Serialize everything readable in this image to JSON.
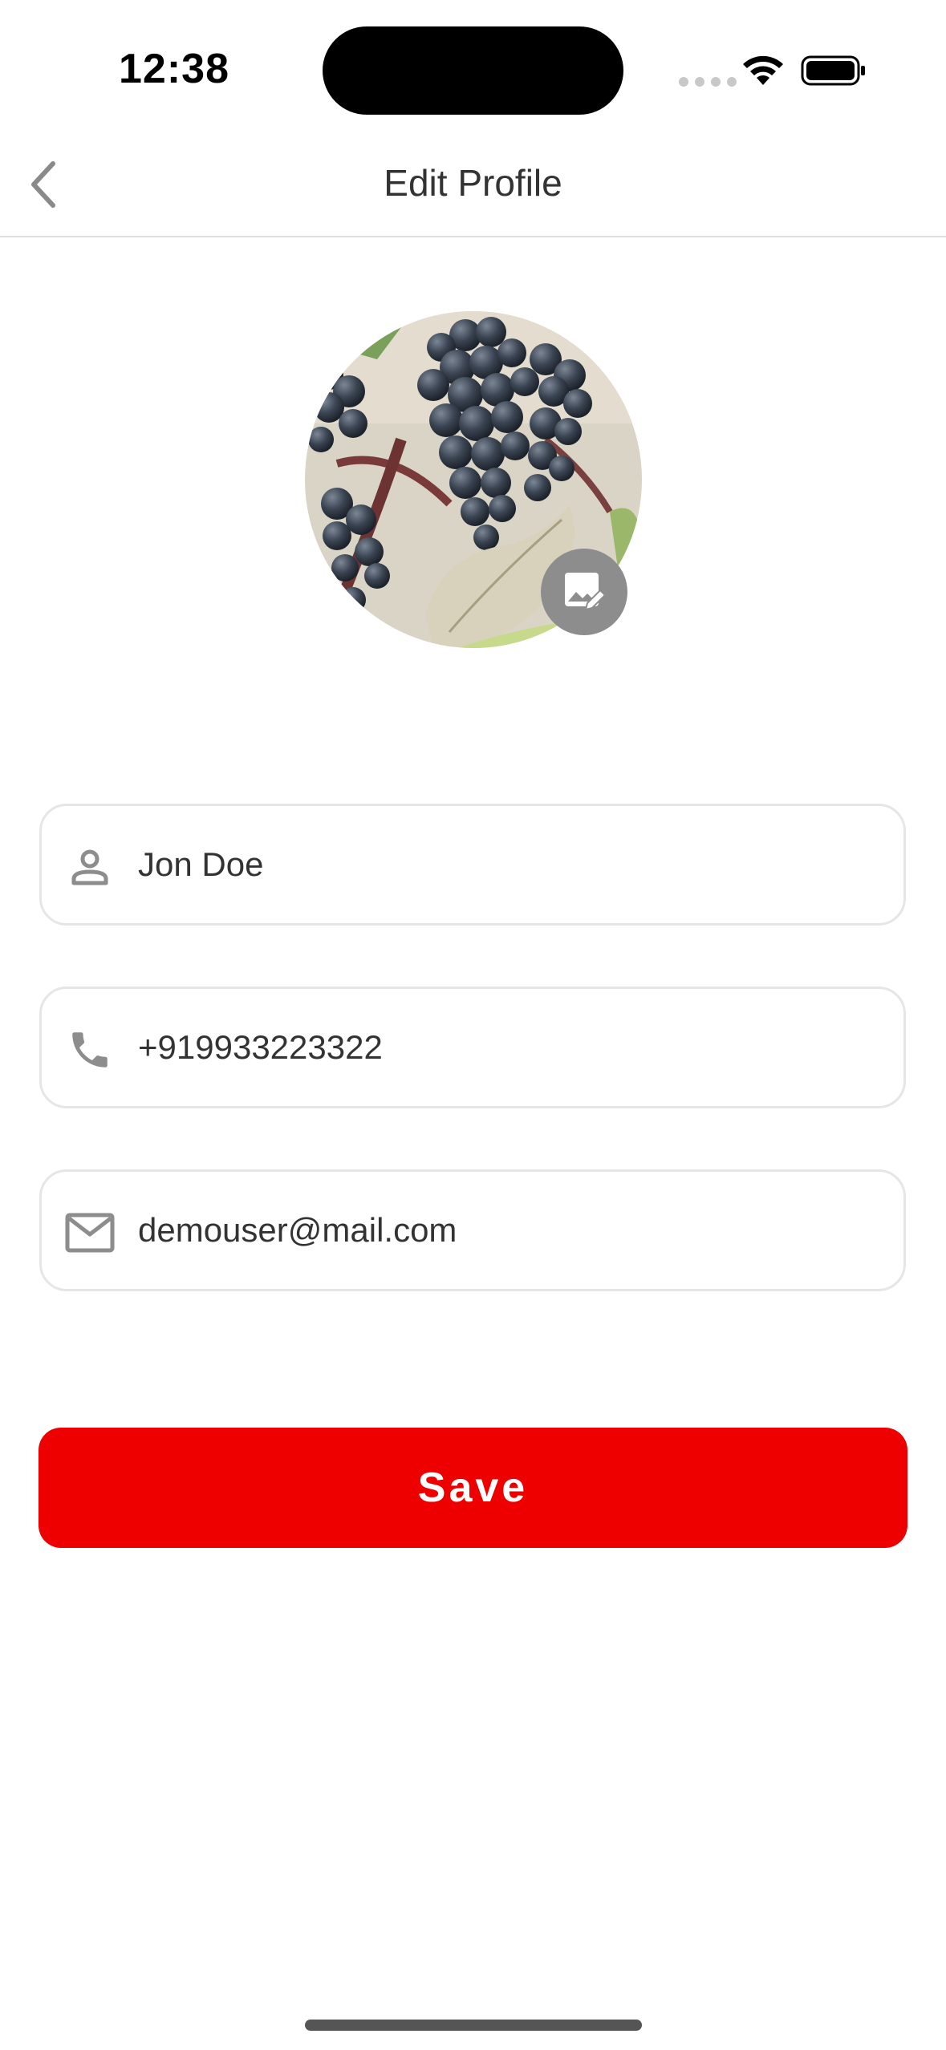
{
  "status_bar": {
    "time": "12:38"
  },
  "header": {
    "title": "Edit Profile",
    "back_icon": "chevron-left-icon"
  },
  "avatar": {
    "edit_icon": "image-edit-icon"
  },
  "form": {
    "name": {
      "value": "Jon Doe",
      "icon": "person-icon"
    },
    "phone": {
      "value": "+919933223322",
      "icon": "phone-icon"
    },
    "email": {
      "value": "demouser@mail.com",
      "icon": "mail-icon"
    }
  },
  "actions": {
    "save_label": "Save"
  },
  "colors": {
    "accent": "#ee0000",
    "icon_gray": "#8d8d8d",
    "border": "#e6e6e6",
    "text": "#333333"
  }
}
